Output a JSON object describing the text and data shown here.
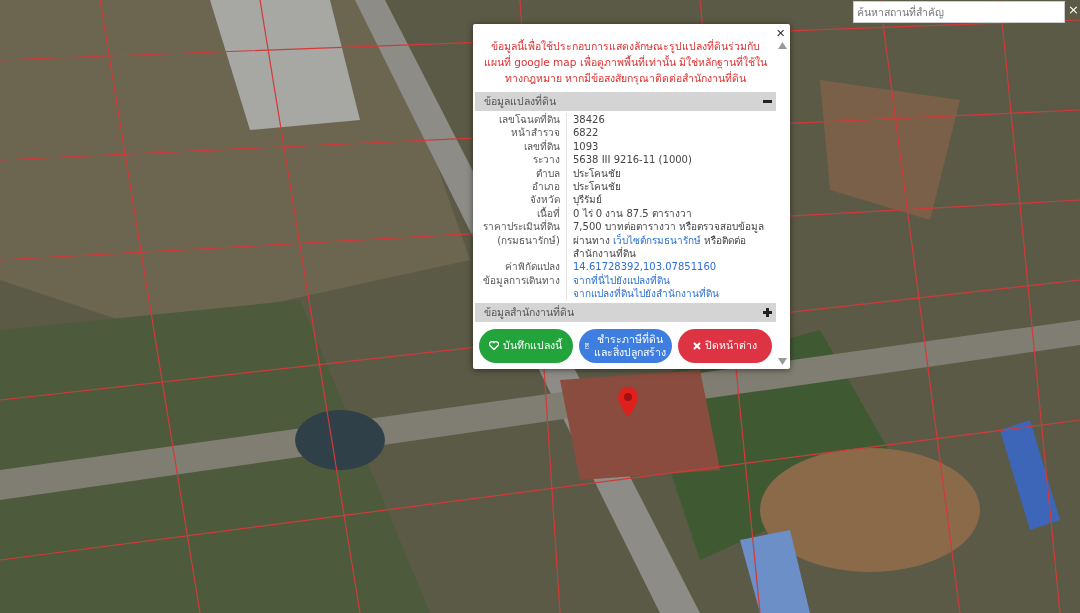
{
  "search": {
    "placeholder": "ค้นหาสถานที่สำคัญ",
    "clear_icon": "×"
  },
  "popup": {
    "close": "×",
    "notice": "ข้อมูลนี้เพื่อใช้ประกอบการแสดงลักษณะรูปแปลงที่ดินร่วมกับแผนที่ google map เพื่อดูภาพพื้นที่เท่านั้น มิใช่หลักฐานที่ใช้ในทางกฎหมาย หากมีข้อสงสัยกรุณาติดต่อสำนักงานที่ดิน",
    "sections": [
      {
        "title": "ข้อมูลแปลงที่ดิน",
        "expanded": true,
        "rows": [
          {
            "label": "เลขโฉนดที่ดิน",
            "kind": "text",
            "value": "38426"
          },
          {
            "label": "หน้าสำรวจ",
            "kind": "text",
            "value": "6822"
          },
          {
            "label": "เลขที่ดิน",
            "kind": "text",
            "value": "1093"
          },
          {
            "label": "ระวาง",
            "kind": "text",
            "value": "5638 III 9216-11 (1000)"
          },
          {
            "label": "ตำบล",
            "kind": "text",
            "value": "ประโคนชัย"
          },
          {
            "label": "อำเภอ",
            "kind": "text",
            "value": "ประโคนชัย"
          },
          {
            "label": "จังหวัด",
            "kind": "text",
            "value": "บุรีรัมย์"
          },
          {
            "label": "เนื้อที่",
            "kind": "text",
            "value": "0 ไร่ 0 งาน 87.5 ตารางวา"
          },
          {
            "label": "ราคาประเมินที่ดิน (กรมธนารักษ์)",
            "kind": "mixed",
            "before": "7,500 บาทต่อตารางวา หรือตรวจสอบข้อมูลผ่านทาง",
            "link": "เว็บไซต์กรมธนารักษ์",
            "after": "หรือติดต่อสำนักงานที่ดิน"
          },
          {
            "label": "ค่าพิกัดแปลง",
            "kind": "links",
            "links": [
              "14.61728392,103.07851160"
            ]
          },
          {
            "label": "ข้อมูลการเดินทาง",
            "kind": "links",
            "links": [
              "จากที่นี่ไปยังแปลงที่ดิน",
              "จากแปลงที่ดินไปยังสำนักงานที่ดิน"
            ]
          }
        ]
      },
      {
        "title": "ข้อมูลสำนักงานที่ดิน",
        "expanded": false
      }
    ],
    "buttons": [
      {
        "label": "บันทึกแปลงนี้",
        "kind": "save"
      },
      {
        "label": "ชำระภาษีที่ดินและสิ่งปลูกสร้าง",
        "kind": "tax"
      },
      {
        "label": "ปิดหน้าต่าง",
        "kind": "close"
      }
    ]
  }
}
